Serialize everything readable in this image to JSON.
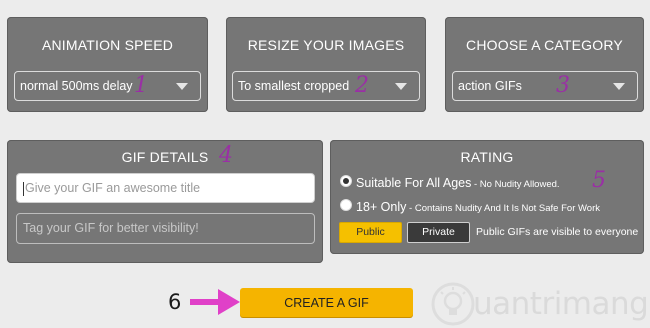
{
  "animation_speed": {
    "title": "ANIMATION SPEED",
    "selected": "normal 500ms delay",
    "marker": "1"
  },
  "resize": {
    "title": "RESIZE YOUR IMAGES",
    "selected": "To smallest cropped",
    "marker": "2"
  },
  "category": {
    "title": "CHOOSE A CATEGORY",
    "selected": "action GIFs",
    "marker": "3"
  },
  "gif_details": {
    "title": "GIF DETAILS",
    "marker": "4",
    "title_placeholder": "Give your GIF an awesome title",
    "tags_placeholder": "Tag your GIF for better visibility!"
  },
  "rating": {
    "title": "RATING",
    "marker": "5",
    "options": [
      {
        "label": "Suitable For All Ages",
        "note": " - No Nudity Allowed.",
        "checked": true
      },
      {
        "label": "18+ Only",
        "note": " - Contains Nudity And It Is Not Safe For Work",
        "checked": false
      }
    ],
    "public_label": "Public",
    "private_label": "Private",
    "visibility_note": "Public GIFs are visible to everyone"
  },
  "create": {
    "label": "CREATE A GIF",
    "marker": "6"
  },
  "watermark": {
    "text": "uantrimang",
    "icon": "lightbulb-logo-icon"
  },
  "colors": {
    "panel": "#767676",
    "marker": "#9a2fa5",
    "arrow": "#e040c8",
    "create_button": "#f5b400",
    "public_button": "#f5c000",
    "private_button": "#3a3a3a"
  }
}
